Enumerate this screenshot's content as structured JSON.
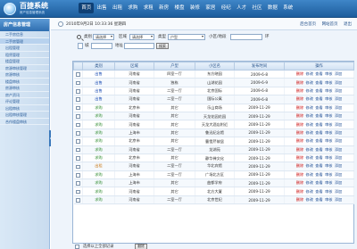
{
  "brand": {
    "name": "百捷系统",
    "subtitle": "房产信息管理系统"
  },
  "nav": [
    {
      "label": "首页"
    },
    {
      "label": "出售"
    },
    {
      "label": "出租"
    },
    {
      "label": "求购"
    },
    {
      "label": "求租"
    },
    {
      "label": "新房"
    },
    {
      "label": "楼盘"
    },
    {
      "label": "装修"
    },
    {
      "label": "家居"
    },
    {
      "label": "经纪"
    },
    {
      "label": "人才"
    },
    {
      "label": "社区"
    },
    {
      "label": "数据"
    },
    {
      "label": "系统"
    }
  ],
  "sidebar": {
    "title": "房产信息管理",
    "items": [
      {
        "label": "二手房信息"
      },
      {
        "label": "二手房管理"
      },
      {
        "label": "出租管理"
      },
      {
        "label": "租赁管理"
      },
      {
        "label": "楼盘管理"
      },
      {
        "label": "房源审核管理"
      },
      {
        "label": "房源审核"
      },
      {
        "label": "楼盘审核"
      },
      {
        "label": "房源审核"
      },
      {
        "label": "房产资讯"
      },
      {
        "label": "评论管理"
      },
      {
        "label": "出租审核"
      },
      {
        "label": "出租审核管理"
      },
      {
        "label": "合作楼盘审核"
      }
    ]
  },
  "infobar": {
    "datetime": "2010年9月2日 10:33:36 星期四",
    "links": [
      {
        "label": "后台首页"
      },
      {
        "label": "网站首页"
      },
      {
        "label": "退出"
      }
    ]
  },
  "filters": {
    "type_label": "类别",
    "type_value": "请选择",
    "district_label": "区域",
    "district_value": "请选择",
    "category_label": "类型",
    "category_value": "户型",
    "community_label": "小区/地段",
    "ring_label": "环",
    "city_label": "城",
    "address_label": "地址",
    "search_label": "搜索"
  },
  "table": {
    "headers": [
      "",
      "类别",
      "区域",
      "户型",
      "小区名",
      "发布时间",
      "操作"
    ],
    "ops": {
      "delete": "删除",
      "edit": "修改",
      "view": "查看",
      "audit": "审核",
      "add": "添加"
    },
    "rows": [
      {
        "type": "出售",
        "area": "河南省",
        "layout": "四室一厅",
        "name": "东方晓园",
        "date": "2009-6-8",
        "type_color": "blue"
      },
      {
        "type": "出售",
        "area": "河南省",
        "layout": "独栋",
        "name": "山湖花园",
        "date": "2009-6-9",
        "type_color": "blue"
      },
      {
        "type": "出售",
        "area": "河南省",
        "layout": "二室一厅",
        "name": "北京国际",
        "date": "2009-6-8",
        "type_color": "blue"
      },
      {
        "type": "出售",
        "area": "河南省",
        "layout": "二室一厅",
        "name": "国际公寓",
        "date": "2009-6-8",
        "type_color": "blue"
      },
      {
        "type": "求购",
        "area": "北京市",
        "layout": "其它",
        "name": "乐山商场",
        "date": "2009-11-29",
        "type_color": "green"
      },
      {
        "type": "求购",
        "area": "河南省",
        "layout": "其它",
        "name": "天龙花园花园",
        "date": "2009-11-29",
        "type_color": "green"
      },
      {
        "type": "求购",
        "area": "河南省",
        "layout": "其它",
        "name": "天龙大酒店附近",
        "date": "2009-11-29",
        "type_color": "green"
      },
      {
        "type": "求购",
        "area": "上海市",
        "layout": "其它",
        "name": "鲁迅纪念馆",
        "date": "2009-11-29",
        "type_color": "green"
      },
      {
        "type": "求购",
        "area": "北京市",
        "layout": "其它",
        "name": "曹雪芹故居",
        "date": "2009-11-29",
        "type_color": "green"
      },
      {
        "type": "求购",
        "area": "河南省",
        "layout": "二室一厅",
        "name": "龙湖苑",
        "date": "2009-11-29",
        "type_color": "green"
      },
      {
        "type": "求购",
        "area": "北京市",
        "layout": "其它",
        "name": "静华禅文化",
        "date": "2009-11-29",
        "type_color": "green"
      },
      {
        "type": "出租",
        "area": "河南省",
        "layout": "二室一厅",
        "name": "华北宾馆",
        "date": "2009-11-29",
        "type_color": "orange"
      },
      {
        "type": "求购",
        "area": "上海市",
        "layout": "二室一厅",
        "name": "广场北方区",
        "date": "2009-11-29",
        "type_color": "green"
      },
      {
        "type": "求购",
        "area": "上海市",
        "layout": "其它",
        "name": "曲都学府",
        "date": "2009-11-29",
        "type_color": "green"
      },
      {
        "type": "求购",
        "area": "河南省",
        "layout": "其它",
        "name": "北方大厦",
        "date": "2009-11-29",
        "type_color": "green"
      },
      {
        "type": "求购",
        "area": "河南省",
        "layout": "二室一厅",
        "name": "北京世纪",
        "date": "2009-11-29",
        "type_color": "green"
      }
    ]
  },
  "footer": {
    "select_all_label": "选择以上全部记录",
    "delete_label": "删除"
  }
}
